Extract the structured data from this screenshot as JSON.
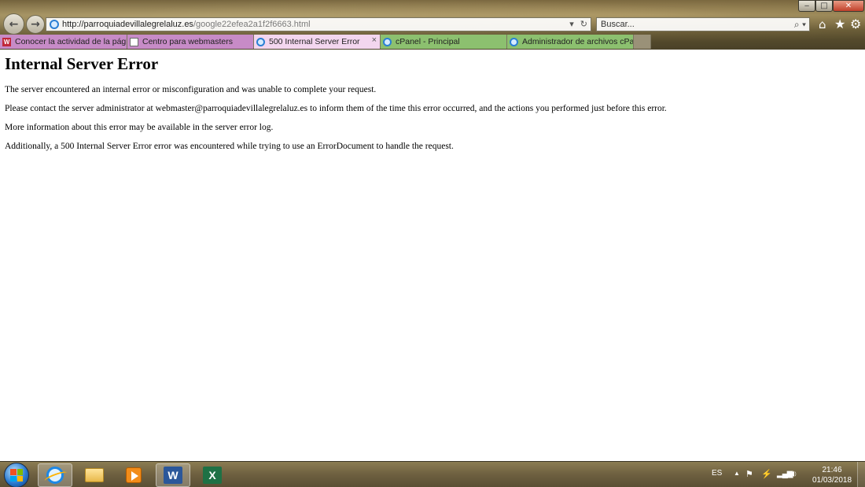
{
  "browser": {
    "address": {
      "domain_part": "http://parroquiadevillalegrelaluz.es",
      "path_part": "/google22efea2a1f2f6663.html"
    },
    "search_placeholder": "Buscar...",
    "tabs": [
      {
        "label": "Conocer la actividad de la pági...",
        "icon": "wix-icon",
        "bg": "#c78bc7",
        "active": false
      },
      {
        "label": "Centro para webmasters",
        "icon": "webmaster-tools-icon",
        "bg": "#c78bc7",
        "active": false
      },
      {
        "label": "500 Internal Server Error",
        "icon": "ie-page-icon",
        "bg": "#f3d6ef",
        "active": true
      },
      {
        "label": "cPanel - Principal",
        "icon": "ie-page-icon",
        "bg": "#8cc06f",
        "active": false
      },
      {
        "label": "Administrador de archivos cPa...",
        "icon": "ie-page-icon",
        "bg": "#8cc06f",
        "active": false
      }
    ],
    "close_tab_glyph": "×"
  },
  "page": {
    "heading": "Internal Server Error",
    "paragraphs": [
      "The server encountered an internal error or misconfiguration and was unable to complete your request.",
      "Please contact the server administrator at webmaster@parroquiadevillalegrelaluz.es to inform them of the time this error occurred, and the actions you performed just before this error.",
      "More information about this error may be available in the server error log.",
      "Additionally, a 500 Internal Server Error error was encountered while trying to use an ErrorDocument to handle the request."
    ]
  },
  "taskbar": {
    "apps": [
      "internet-explorer",
      "windows-explorer",
      "media-player",
      "word",
      "excel"
    ],
    "word_letter": "W",
    "excel_letter": "X",
    "tray": {
      "language": "ES",
      "time": "21:46",
      "date": "01/03/2018"
    }
  },
  "colors": {
    "chrome_bg": "#6b5a35",
    "active_tab": "#f3d6ef",
    "purple_tab": "#c78bc7",
    "green_tab": "#8cc06f",
    "close_button": "#c0402a"
  }
}
